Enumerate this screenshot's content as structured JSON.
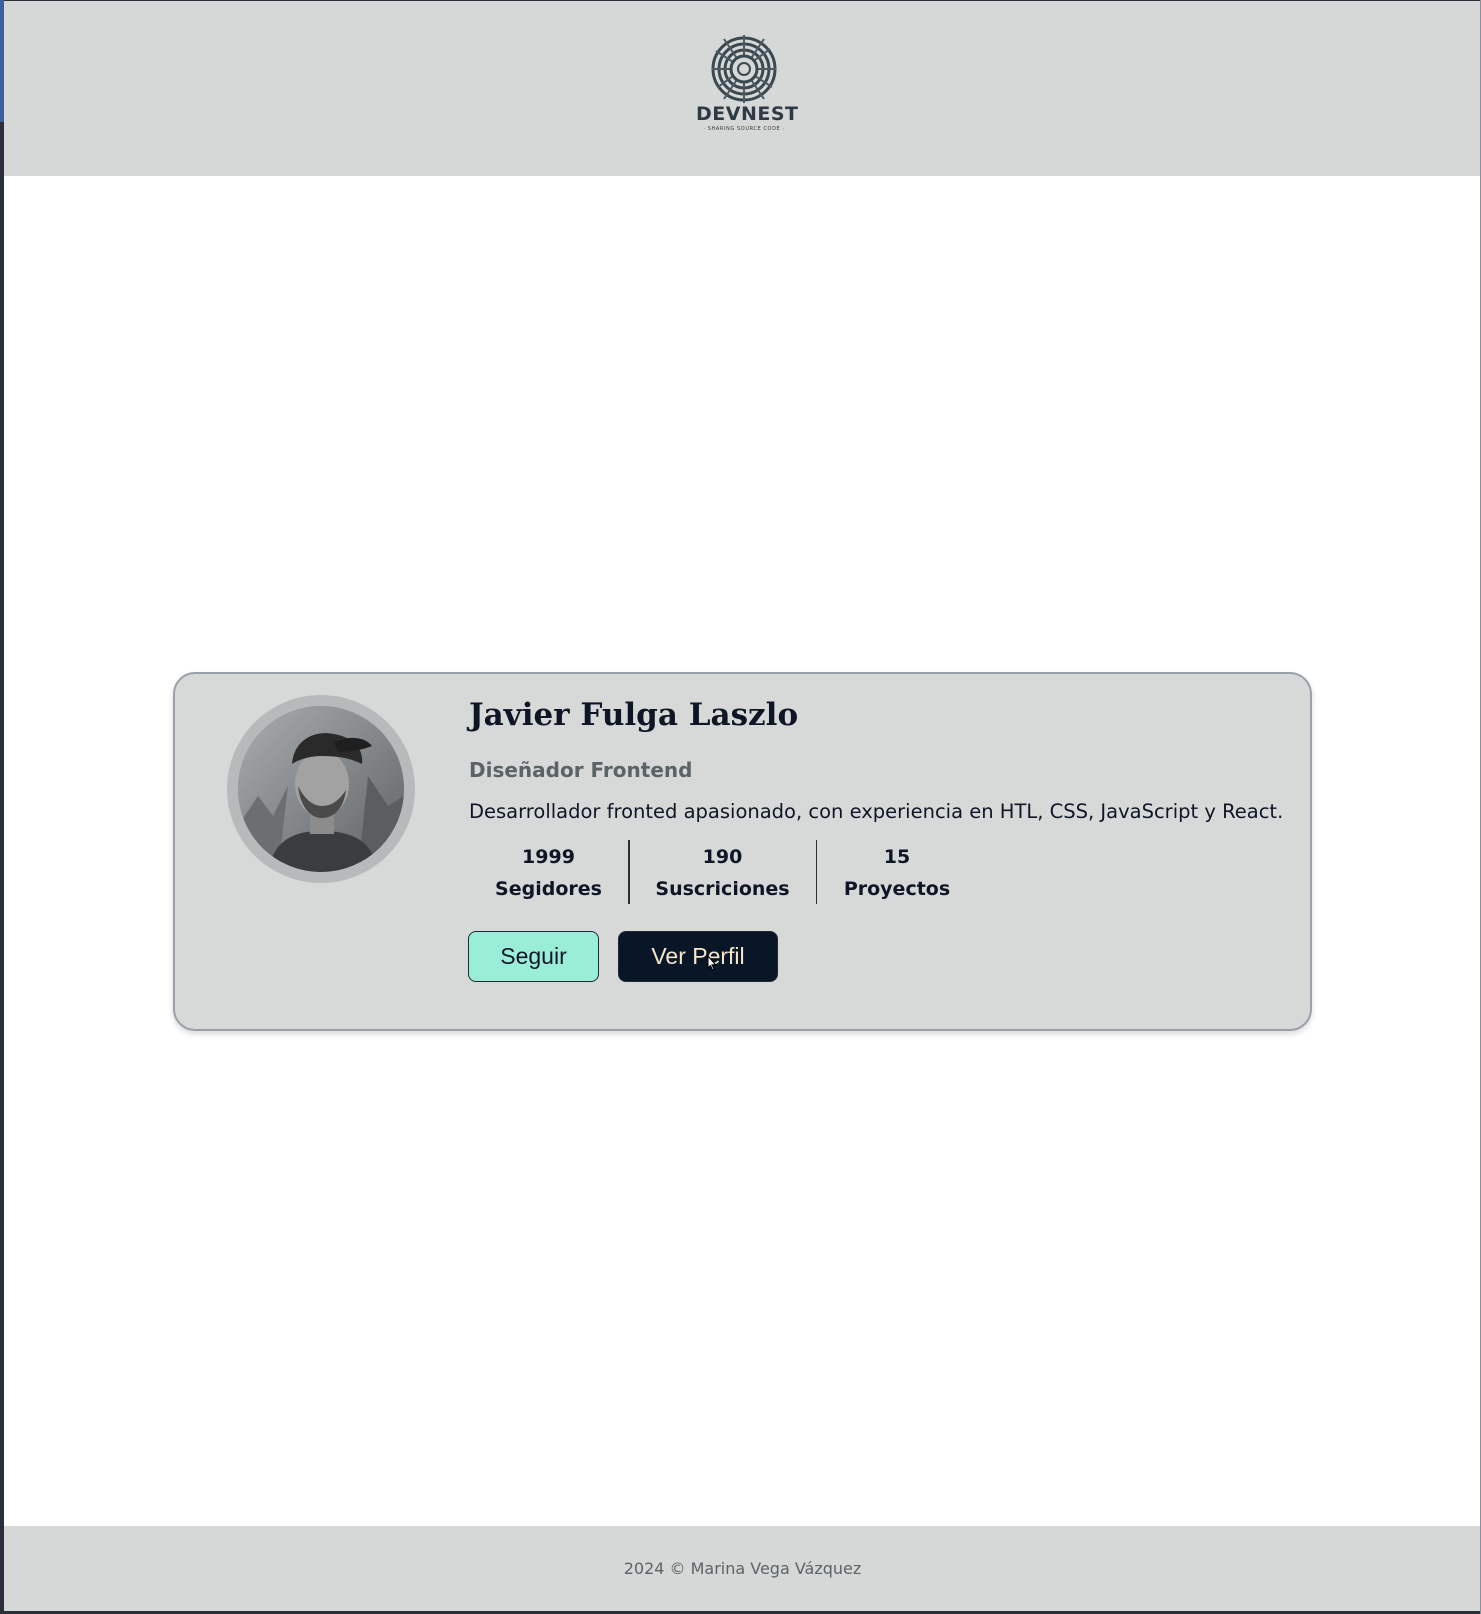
{
  "header": {
    "logo_word": "DEVNEST",
    "logo_tagline": "· SHARING SOURCE CODE ·"
  },
  "profile": {
    "name": "Javier Fulga Laszlo",
    "role": "Diseñador Frontend",
    "bio": "Desarrollador fronted apasionado, con experiencia en HTL, CSS, JavaScript y React.",
    "stats": [
      {
        "value": "1999",
        "label": "Segidores"
      },
      {
        "value": "190",
        "label": "Suscriciones"
      },
      {
        "value": "15",
        "label": "Proyectos"
      }
    ],
    "follow_label": "Seguir",
    "view_profile_label": "Ver Perfil"
  },
  "footer": {
    "text": "2024 © Marina Vega Vázquez"
  },
  "colors": {
    "header_bg": "#d6d8d8",
    "card_bg": "#d7d9d9",
    "follow_button": "#9aeed8",
    "profile_button": "#081628",
    "text_dark": "#0e1626"
  }
}
